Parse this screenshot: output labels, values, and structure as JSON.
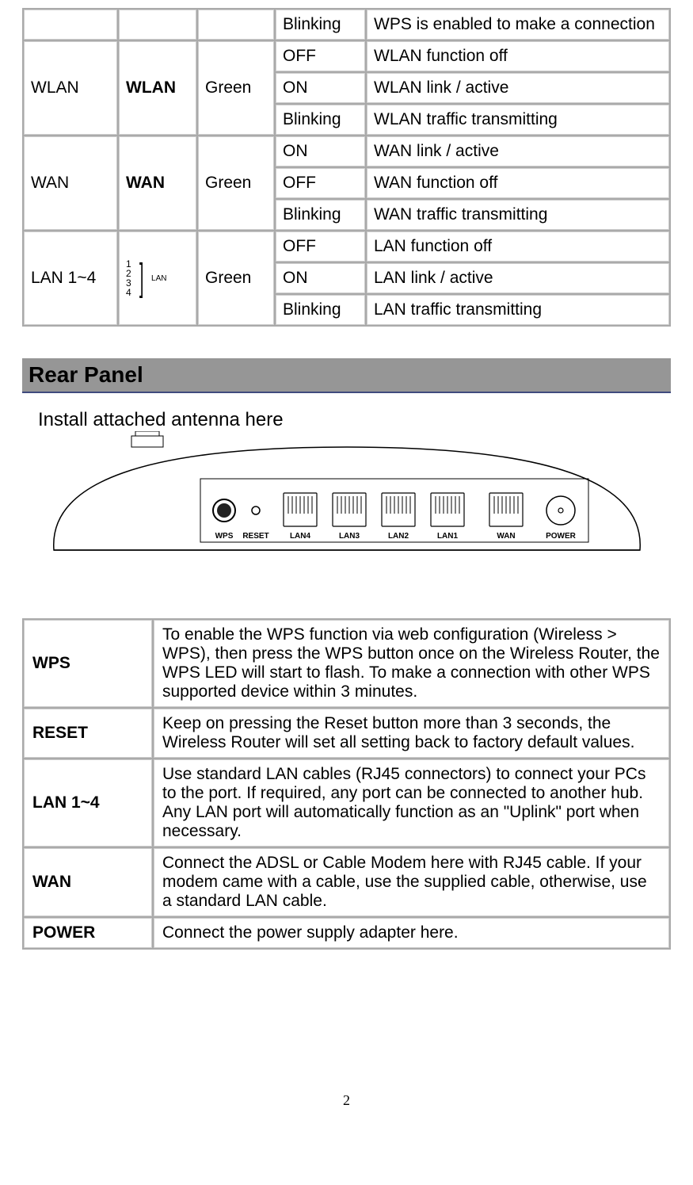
{
  "led_table": {
    "rows": [
      {
        "name": "",
        "label": "",
        "color": "",
        "states": [
          {
            "state": "Blinking",
            "desc": "WPS is enabled to make a connection"
          }
        ]
      },
      {
        "name": "WLAN",
        "label": "WLAN",
        "color": "Green",
        "states": [
          {
            "state": "OFF",
            "desc": "WLAN function off"
          },
          {
            "state": "ON",
            "desc": "WLAN link / active"
          },
          {
            "state": "Blinking",
            "desc": "WLAN traffic transmitting"
          }
        ]
      },
      {
        "name": "WAN",
        "label": "WAN",
        "color": "Green",
        "states": [
          {
            "state": "ON",
            "desc": "WAN link / active"
          },
          {
            "state": "OFF",
            "desc": "WAN function off"
          },
          {
            "state": "Blinking",
            "desc": "WAN traffic transmitting"
          }
        ]
      },
      {
        "name": "LAN 1~4",
        "label": "LAN",
        "color": "Green",
        "states": [
          {
            "state": "OFF",
            "desc": "LAN function off"
          },
          {
            "state": "ON",
            "desc": "LAN link / active"
          },
          {
            "state": "Blinking",
            "desc": "LAN traffic transmitting"
          }
        ]
      }
    ]
  },
  "section_title": "Rear Panel",
  "antenna_caption": "Install attached antenna here",
  "port_labels": {
    "wps": "WPS",
    "reset": "RESET",
    "lan4": "LAN4",
    "lan3": "LAN3",
    "lan2": "LAN2",
    "lan1": "LAN1",
    "wan": "WAN",
    "power": "POWER"
  },
  "rear_table": {
    "rows": [
      {
        "label": "WPS",
        "desc": "To enable the WPS function via web configuration (Wireless > WPS), then press the WPS button once on the Wireless Router, the WPS LED will start to flash. To make a connection with other WPS supported device within 3 minutes."
      },
      {
        "label": "RESET",
        "desc": "Keep on pressing the Reset button more than 3 seconds, the Wireless  Router will set all setting back to factory default values."
      },
      {
        "label": "LAN  1~4",
        "desc": "Use standard LAN cables (RJ45 connectors) to connect your PCs to the port. If required, any port can be connected to another hub. Any LAN port will automatically function as an \"Uplink\" port when necessary."
      },
      {
        "label": "WAN",
        "desc": "Connect the ADSL or Cable Modem here with RJ45 cable. If your modem came with a cable, use the supplied cable, otherwise, use a standard LAN cable."
      },
      {
        "label": "POWER",
        "desc": "Connect the power supply adapter here."
      }
    ]
  },
  "page_number": "2"
}
